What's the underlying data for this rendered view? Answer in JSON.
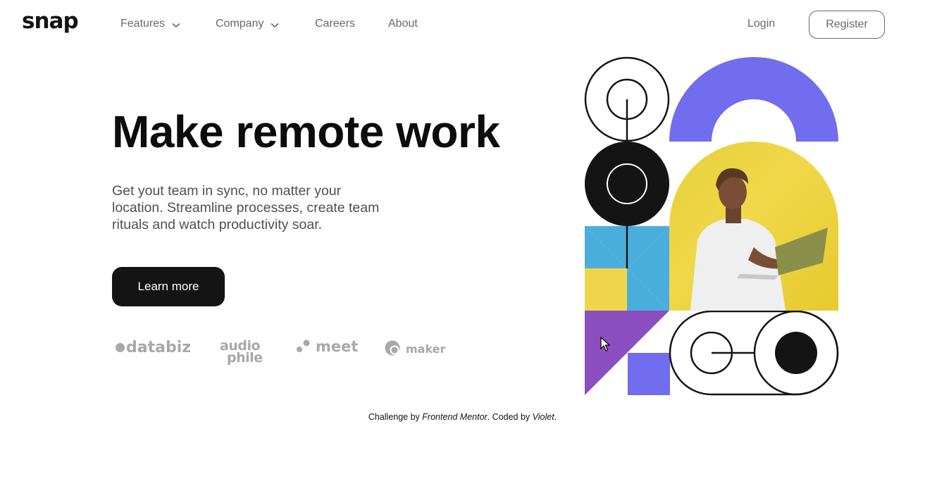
{
  "brand": {
    "logo": "snap"
  },
  "nav": {
    "items": [
      {
        "label": "Features"
      },
      {
        "label": "Company"
      },
      {
        "label": "Careers"
      },
      {
        "label": "About"
      }
    ],
    "login_label": "Login",
    "register_label": "Register"
  },
  "hero": {
    "title": "Make remote work",
    "description": "Get yout team in sync, no matter your location. Streamline processes, create team rituals and watch productivity soar.",
    "cta_label": "Learn more"
  },
  "clients": {
    "databiz": "databiz",
    "audiophile_top": "audio",
    "audiophile_bottom": "phile",
    "meet": "meet",
    "maker": "maker"
  },
  "footer": {
    "prefix": "Challenge by ",
    "source": "Frontend Mentor",
    "middle": ". Coded by ",
    "author": "Violet",
    "suffix": "."
  },
  "colors": {
    "primary": "#141414",
    "muted": "#696969",
    "logo_gray": "#a8a8a8",
    "purple": "#726cee",
    "blue": "#4aaedc",
    "yellow": "#f0d54a",
    "violet": "#8b4ebf"
  },
  "icons": {
    "chevron": "chevron-down-icon",
    "cursor": "mouse-pointer-icon"
  }
}
